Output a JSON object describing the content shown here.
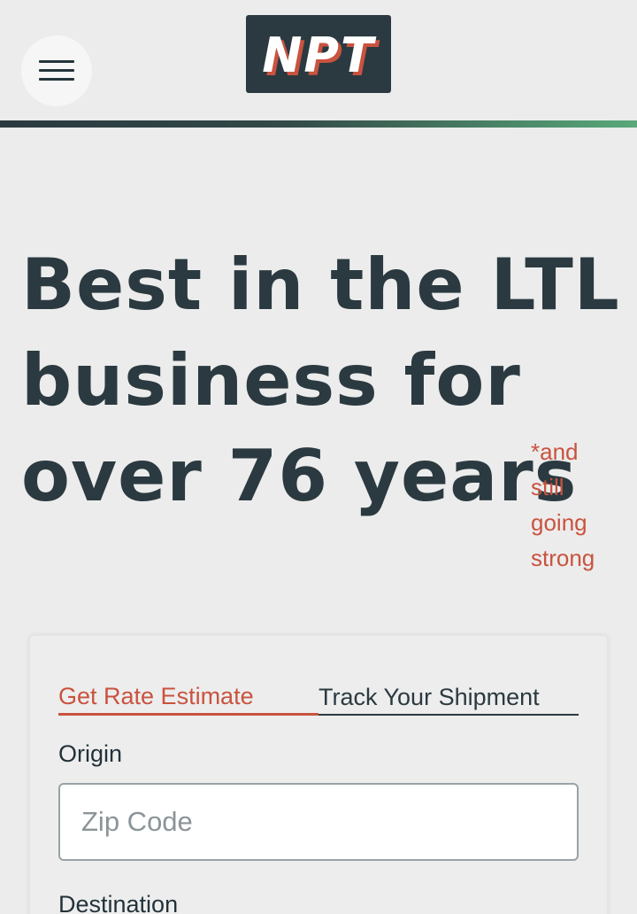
{
  "header": {
    "menu_icon": "hamburger-menu-icon",
    "logo_text": "NPT",
    "colors": {
      "logo_bg": "#2b3a40",
      "logo_text": "#ffffff",
      "logo_shadow": "#c9533f",
      "rule_start": "#2b3a40",
      "rule_end": "#5aa87a"
    }
  },
  "hero": {
    "title_lines": [
      "Best in the LTL",
      "business for",
      "over 76 years"
    ],
    "tagline_lines": [
      "*and",
      "still",
      "going",
      "strong"
    ],
    "colors": {
      "title": "#2b3a40",
      "tagline": "#c9533f"
    }
  },
  "form": {
    "tabs": [
      {
        "label": "Get Rate Estimate",
        "active": true
      },
      {
        "label": "Track Your Shipment",
        "active": false
      }
    ],
    "origin": {
      "label": "Origin",
      "placeholder": "Zip Code",
      "value": ""
    },
    "destination": {
      "label": "Destination"
    },
    "colors": {
      "accent": "#c9533f",
      "text": "#2b3a40"
    }
  }
}
